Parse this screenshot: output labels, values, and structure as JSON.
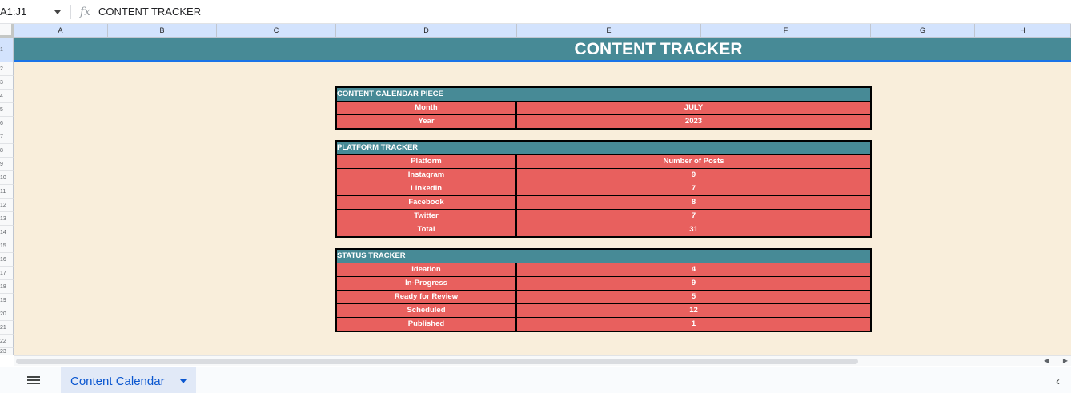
{
  "formula_bar": {
    "name_box": "A1:J1",
    "fx_label": "fx",
    "value": "CONTENT TRACKER"
  },
  "columns": [
    "A",
    "B",
    "C",
    "D",
    "E",
    "F",
    "G",
    "H"
  ],
  "rows": [
    "1",
    "2",
    "3",
    "4",
    "5",
    "6",
    "7",
    "8",
    "9",
    "10",
    "11",
    "12",
    "13",
    "14",
    "15",
    "16",
    "17",
    "18",
    "19",
    "20",
    "21",
    "22",
    "23"
  ],
  "title": "CONTENT TRACKER",
  "calendar": {
    "header": "CONTENT CALENDAR PIECE",
    "rows": [
      {
        "label": "Month",
        "value": "JULY"
      },
      {
        "label": "Year",
        "value": "2023"
      }
    ]
  },
  "platform": {
    "header": "PLATFORM TRACKER",
    "rows": [
      {
        "label": "Platform",
        "value": "Number of Posts"
      },
      {
        "label": "Instagram",
        "value": "9"
      },
      {
        "label": "LinkedIn",
        "value": "7"
      },
      {
        "label": "Facebook",
        "value": "8"
      },
      {
        "label": "Twitter",
        "value": "7"
      },
      {
        "label": "Total",
        "value": "31"
      }
    ]
  },
  "status": {
    "header": "STATUS TRACKER",
    "rows": [
      {
        "label": "Ideation",
        "value": "4"
      },
      {
        "label": "In-Progress",
        "value": "9"
      },
      {
        "label": "Ready for Review",
        "value": "5"
      },
      {
        "label": "Scheduled",
        "value": "12"
      },
      {
        "label": "Published",
        "value": "1"
      }
    ]
  },
  "tabs": {
    "active": "Content Calendar"
  },
  "colors": {
    "header_teal": "#478a96",
    "cell_red": "#e8605e",
    "sheet_bg": "#f9eedb"
  }
}
